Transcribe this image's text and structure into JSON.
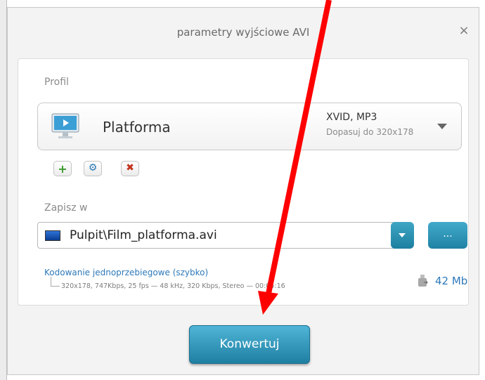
{
  "dialog": {
    "title": "parametry wyjściowe AVI",
    "close_icon": "×"
  },
  "profile": {
    "section_label": "Profil",
    "name": "Platforma",
    "codec": "XVID, MP3",
    "fit": "Dopasuj do 320x178"
  },
  "save": {
    "section_label": "Zapisz w",
    "path": "Pulpit\\Film_platforma.avi",
    "browse_label": "..."
  },
  "encoding": {
    "link": "Kodowanie jednoprzebiegowe (szybko)",
    "details": "320x178, 747Kbps, 25 fps — 48 kHz, 320 Kbps, Stereo — 00:05:16",
    "size": "42 Mb"
  },
  "convert_label": "Konwertuj",
  "colors": {
    "accent": "#2e79b9",
    "button": "#1f7fa3",
    "arrow": "#ff0000"
  }
}
